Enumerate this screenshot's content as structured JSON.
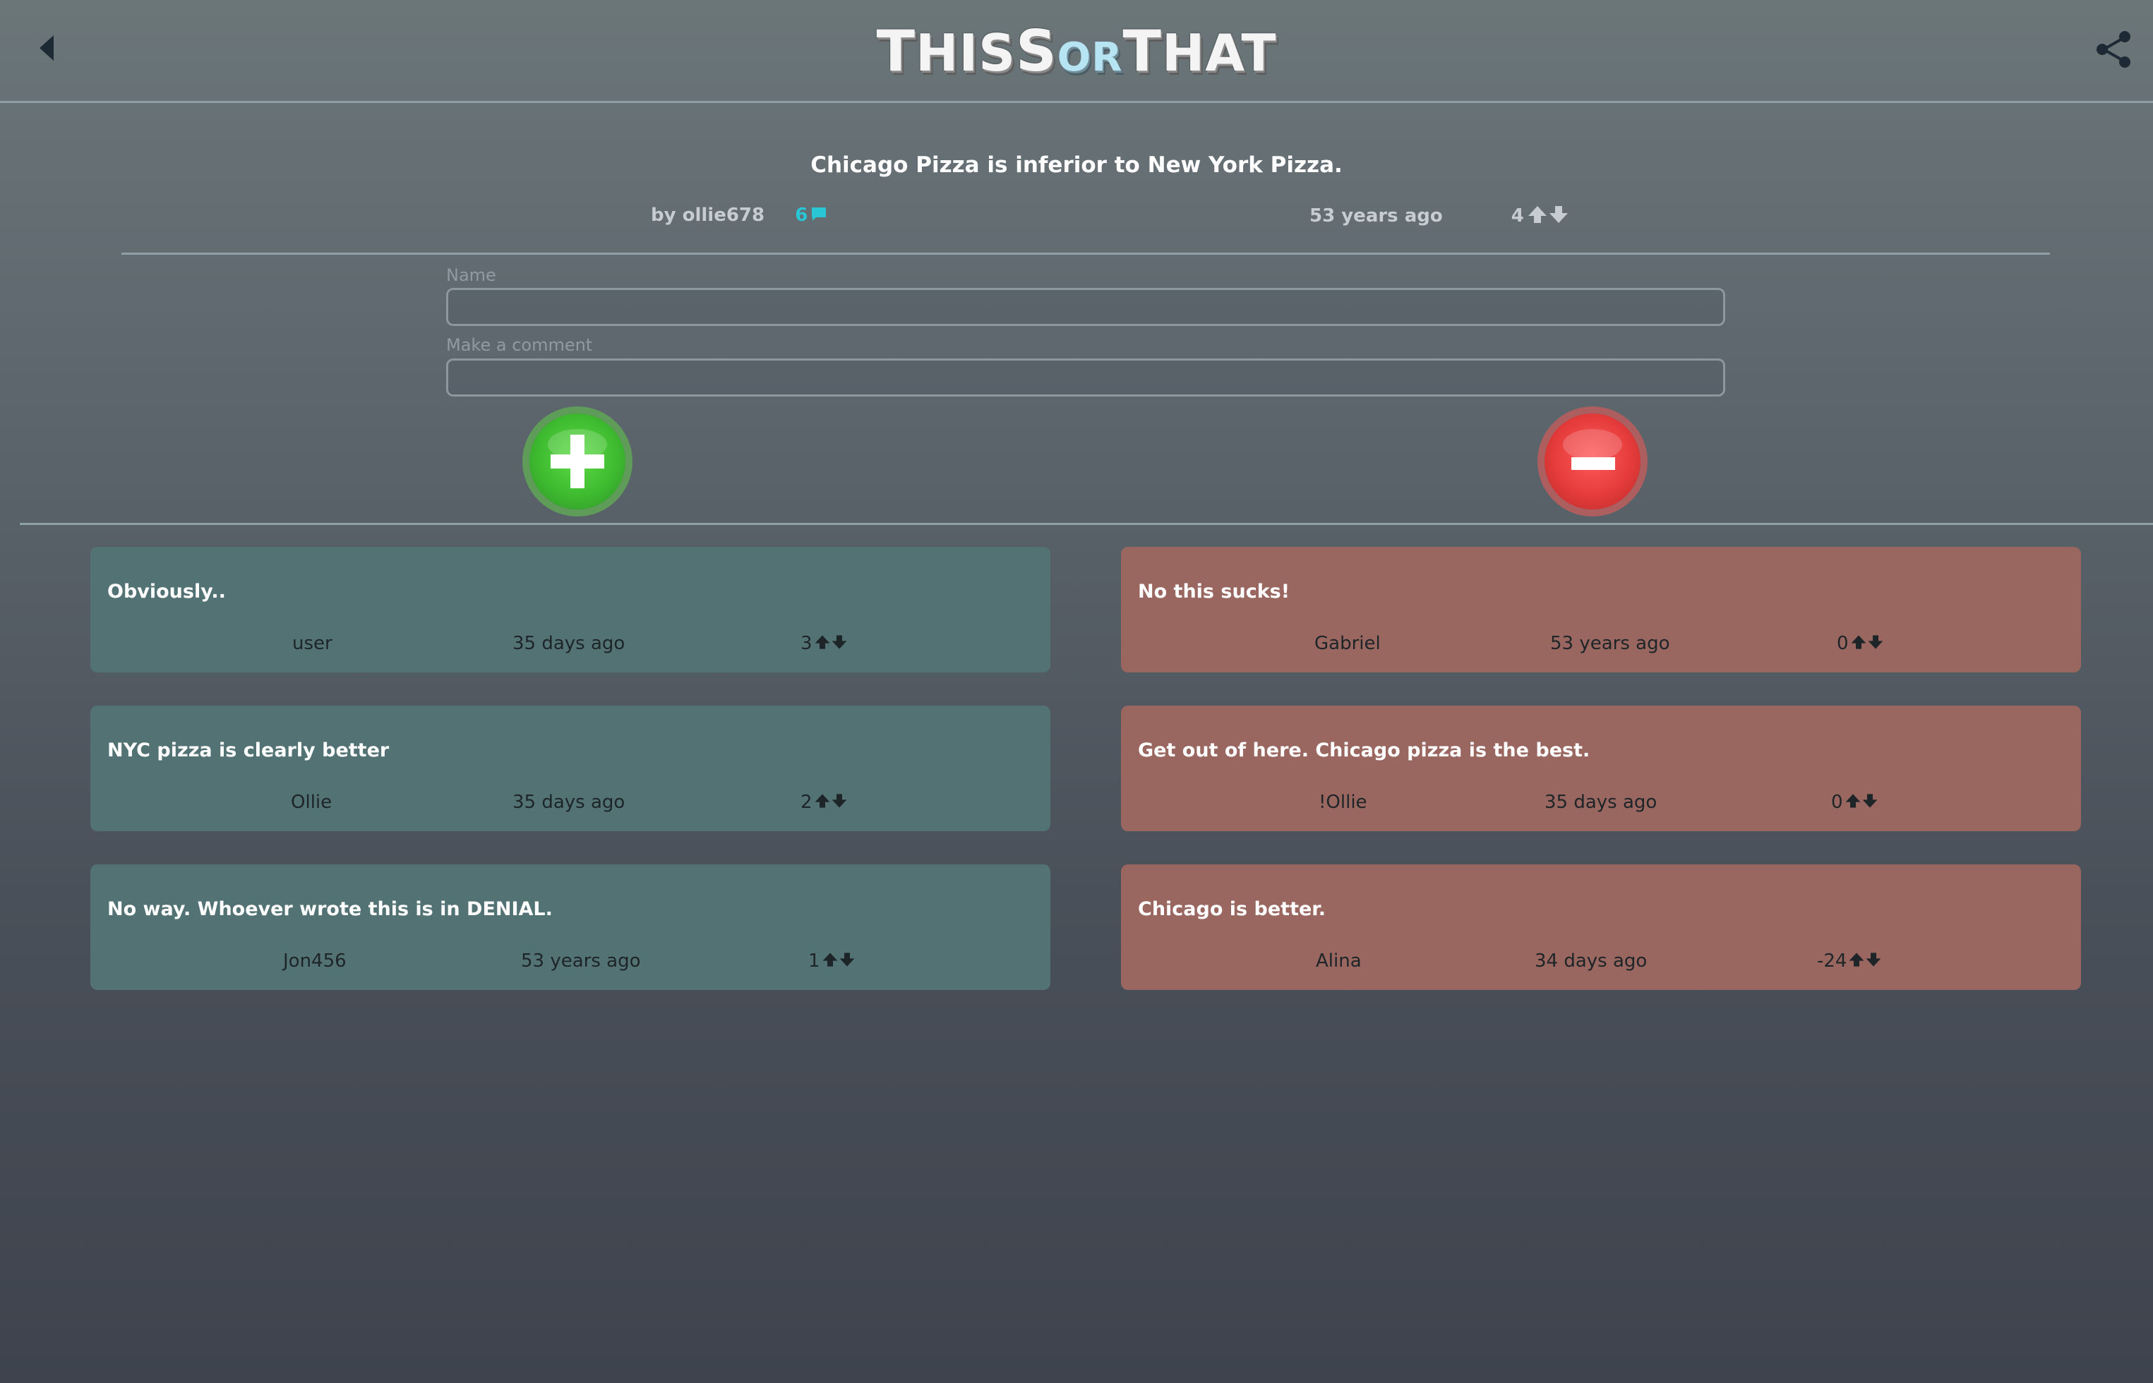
{
  "header": {
    "logo": {
      "this": "THIS",
      "or": "OR",
      "that_t": "T",
      "that_rest": "HAT",
      "th_t": "T",
      "th_rest": "HIS",
      "s": "S"
    },
    "back_icon": "chevron-left-icon",
    "share_icon": "share-icon"
  },
  "post": {
    "title": "Chicago Pizza is inferior to New York Pizza.",
    "author": "by ollie678",
    "comment_count": "6",
    "time": "53 years ago",
    "score": "4"
  },
  "form": {
    "name_label": "Name",
    "comment_label": "Make a comment",
    "name_value": "",
    "comment_value": ""
  },
  "colors": {
    "accent": "#29c7d6",
    "pro_card": "#537274",
    "con_card": "#9a6660",
    "agree_button": "#3fbb30",
    "disagree_button": "#e53b3b"
  },
  "pro_comments": [
    {
      "text": "Obviously..",
      "author": "user",
      "time": "35 days ago",
      "score": "3"
    },
    {
      "text": "NYC pizza is clearly better",
      "author": "Ollie",
      "time": "35 days ago",
      "score": "2"
    },
    {
      "text": "No way. Whoever wrote this is in DENIAL.",
      "author": "Jon456",
      "time": "53 years ago",
      "score": "1"
    }
  ],
  "con_comments": [
    {
      "text": "No this sucks!",
      "author": "Gabriel",
      "time": "53 years ago",
      "score": "0"
    },
    {
      "text": "Get out of here. Chicago pizza is the best.",
      "author": "!Ollie",
      "time": "35 days ago",
      "score": "0"
    },
    {
      "text": "Chicago is better.",
      "author": "Alina",
      "time": "34 days ago",
      "score": "-24"
    }
  ]
}
